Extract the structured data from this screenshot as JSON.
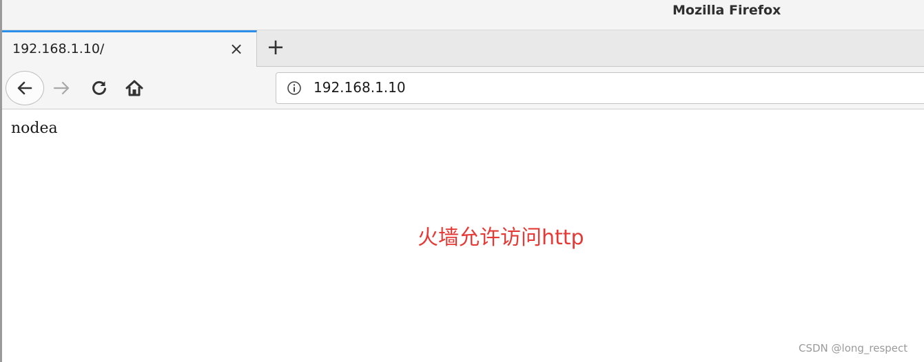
{
  "window": {
    "title": "Mozilla Firefox"
  },
  "tab": {
    "title": "192.168.1.10/",
    "close_label": "×",
    "new_tab_label": "+"
  },
  "navbar": {
    "url": "192.168.1.10"
  },
  "page": {
    "text": "nodea"
  },
  "annotation": {
    "text": "火墙允许访问http",
    "color": "#e53935"
  },
  "watermark": {
    "text": "CSDN @long_respect"
  },
  "icons": [
    "back-arrow-icon",
    "forward-arrow-icon",
    "reload-icon",
    "home-icon",
    "info-icon"
  ],
  "colors": {
    "tab_accent": "#2b8ee8"
  }
}
